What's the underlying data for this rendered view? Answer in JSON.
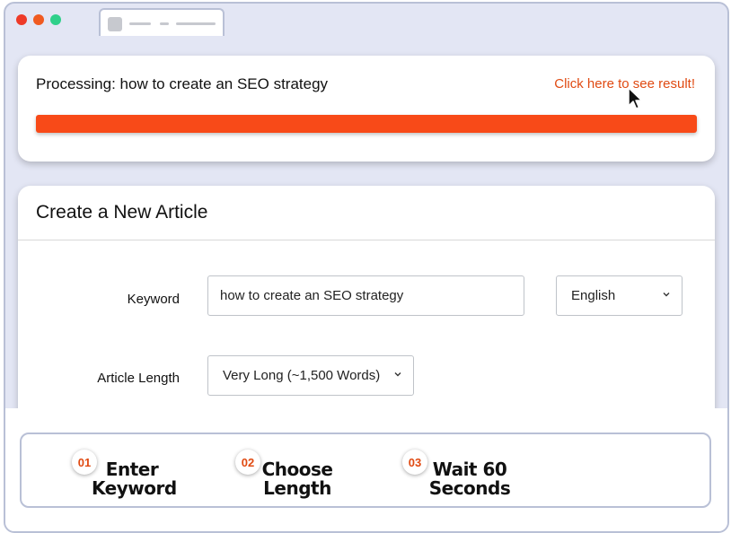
{
  "processing": {
    "title": "Processing: how to create an SEO strategy",
    "result_link": "Click here to see result!",
    "progress": 1.0,
    "accent_color": "#f84a18"
  },
  "create": {
    "title": "Create a New Article",
    "keyword_label": "Keyword",
    "keyword_value": "how to create an SEO strategy",
    "language_value": "English",
    "length_label": "Article Length",
    "length_value": "Very Long (~1,500 Words)"
  },
  "steps": [
    {
      "num": "01",
      "line1": "Enter",
      "line2": "Keyword"
    },
    {
      "num": "02",
      "line1": "Choose",
      "line2": "Length"
    },
    {
      "num": "03",
      "line1": "Wait 60",
      "line2": "Seconds"
    }
  ],
  "icons": {
    "window_controls": [
      "close-icon",
      "minimize-icon",
      "maximize-icon"
    ],
    "cursor": "mouse-pointer-icon",
    "select": "chevron-down-icon"
  }
}
